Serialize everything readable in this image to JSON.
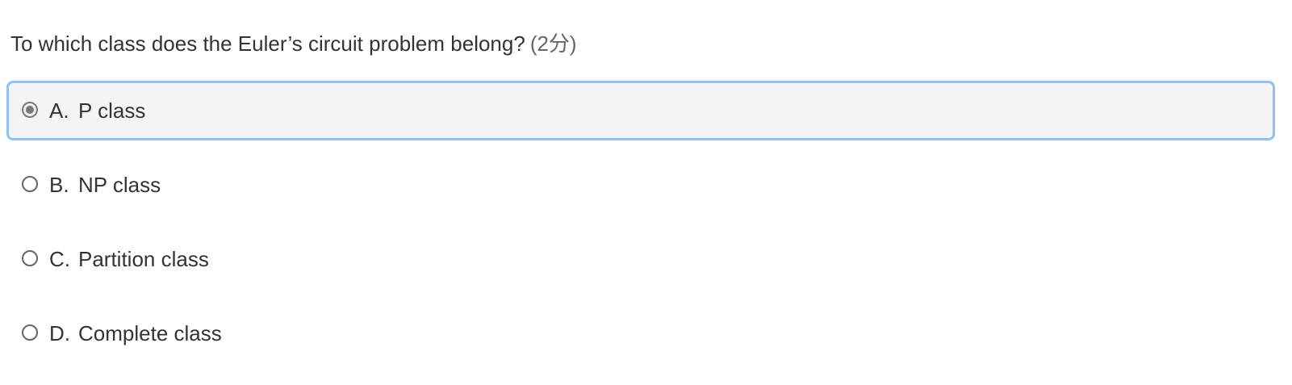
{
  "question": {
    "text": "To which class does the Euler’s circuit problem belong?",
    "score": "(2分)"
  },
  "options": [
    {
      "letter": "A.",
      "label": "P class",
      "selected": true
    },
    {
      "letter": "B.",
      "label": "NP class",
      "selected": false
    },
    {
      "letter": "C.",
      "label": "Partition class",
      "selected": false
    },
    {
      "letter": "D.",
      "label": "Complete class",
      "selected": false
    }
  ],
  "colors": {
    "selected_border": "#90c2f5",
    "selected_background": "#f3f4f6",
    "text": "#333333"
  }
}
